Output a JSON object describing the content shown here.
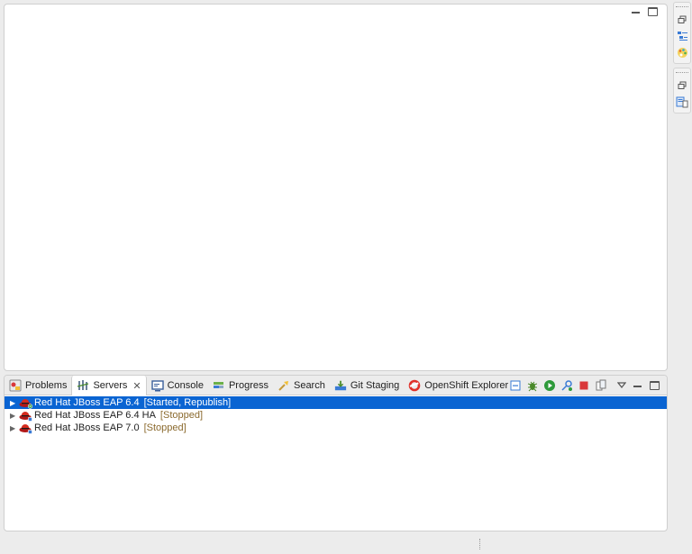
{
  "views": {
    "tabs": [
      {
        "label": "Problems"
      },
      {
        "label": "Servers",
        "close": "✕"
      },
      {
        "label": "Console"
      },
      {
        "label": "Progress"
      },
      {
        "label": "Search"
      },
      {
        "label": "Git Staging"
      },
      {
        "label": "OpenShift Explorer"
      }
    ]
  },
  "servers": [
    {
      "name": "Red Hat JBoss EAP 6.4",
      "state": "[Started, Republish]",
      "selected": true
    },
    {
      "name": "Red Hat JBoss EAP 6.4 HA",
      "state": "[Stopped]",
      "selected": false
    },
    {
      "name": "Red Hat JBoss EAP 7.0",
      "state": "[Stopped]",
      "selected": false
    }
  ],
  "icons": {
    "collapse": "collapse-all-icon",
    "debug": "debug-server-icon",
    "start": "start-server-icon",
    "profile": "profile-server-icon",
    "stop": "stop-server-icon",
    "publish": "publish-icon",
    "menu": "view-menu-icon"
  },
  "colors": {
    "selection": "#0a64d2",
    "state_text": "#8b6a2e",
    "background": "#ececec"
  }
}
